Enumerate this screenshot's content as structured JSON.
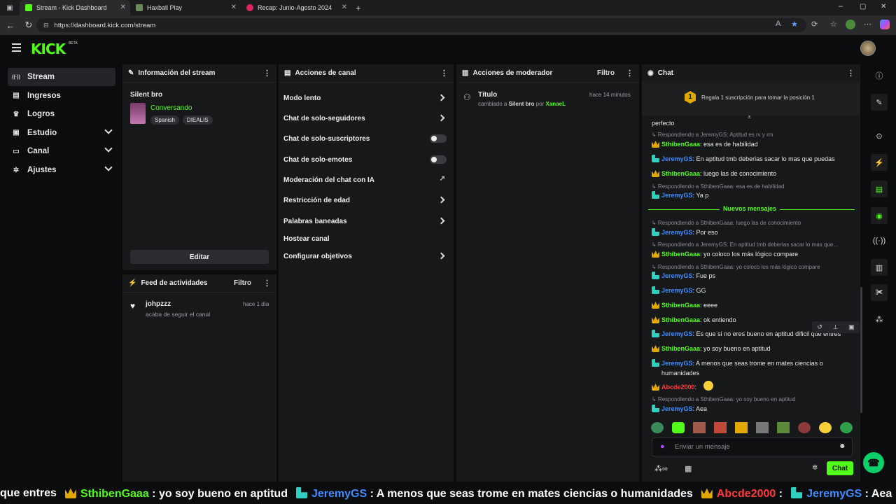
{
  "browser": {
    "tabs": [
      {
        "title": "Stream - Kick Dashboard",
        "active": true
      },
      {
        "title": "Haxball Play",
        "active": false
      },
      {
        "title": "Recap: Junio-Agosto 2024",
        "active": false
      }
    ],
    "url": "https://dashboard.kick.com/stream"
  },
  "app": {
    "logo": "KICK",
    "beta": "BETA"
  },
  "sidebar": {
    "items": [
      {
        "label": "Stream",
        "icon": "broadcast-icon",
        "active": true
      },
      {
        "label": "Ingresos",
        "icon": "revenue-icon"
      },
      {
        "label": "Logros",
        "icon": "trophy-icon"
      },
      {
        "label": "Estudio",
        "icon": "studio-icon",
        "expandable": true
      },
      {
        "label": "Canal",
        "icon": "channel-icon",
        "expandable": true
      },
      {
        "label": "Ajustes",
        "icon": "gear-icon",
        "expandable": true
      }
    ]
  },
  "stream_info": {
    "title": "Información del stream",
    "stream_title": "Silent bro",
    "category": "Conversando",
    "tags": [
      "Spanish",
      "DIEALIS"
    ],
    "edit_label": "Editar"
  },
  "activity": {
    "title": "Feed de actividades",
    "filter": "Filtro",
    "items": [
      {
        "user": "johpzzz",
        "text": "acaba de seguir el canal",
        "time": "hace 1 día"
      }
    ]
  },
  "channel_actions": {
    "title": "Acciones de canal",
    "items": [
      {
        "label": "Modo lento",
        "control": "arrow"
      },
      {
        "label": "Chat de solo-seguidores",
        "control": "arrow"
      },
      {
        "label": "Chat de solo-suscriptores",
        "control": "toggle"
      },
      {
        "label": "Chat de solo-emotes",
        "control": "toggle"
      },
      {
        "label": "Moderación del chat con IA",
        "control": "external"
      },
      {
        "label": "Restricción de edad",
        "control": "arrow"
      },
      {
        "label": "Palabras baneadas",
        "control": "arrow"
      },
      {
        "label": "Hostear canal",
        "control": "none"
      },
      {
        "label": "Configurar objetivos",
        "control": "arrow"
      }
    ]
  },
  "mod_actions": {
    "title": "Acciones de moderador",
    "filter": "Filtro",
    "items": [
      {
        "title": "Título",
        "text_pre": "cambiado a",
        "value": "Silent bro",
        "text_mid": "por",
        "user": "XanaeL",
        "time": "hace 14 minutos"
      }
    ]
  },
  "chat": {
    "title": "Chat",
    "gift_rank": "1",
    "gift_text": "Regala 1 suscripción para tomar la posición 1",
    "new_messages": "Nuevos mensajes",
    "input_placeholder": "Enviar un mensaje",
    "send_label": "Chat",
    "messages": [
      {
        "text": "perfecto"
      },
      {
        "reply": "Respondiendo a JeremyGS: Aptitud es rv y rm",
        "user": "SthibenGaaa",
        "badge": "sub",
        "color": "#53fc18",
        "text": "esa es de habilidad"
      },
      {
        "user": "JeremyGS",
        "badge": "mod",
        "color": "#3f8cff",
        "text": "En aptitud tmb deberias sacar lo mas que puedas"
      },
      {
        "user": "SthibenGaaa",
        "badge": "sub",
        "color": "#53fc18",
        "text": "luego las de conocimiento"
      },
      {
        "reply": "Respondiendo a SthibenGaaa: esa es de habilidad",
        "user": "JeremyGS",
        "badge": "mod",
        "color": "#3f8cff",
        "text": "Ya p"
      },
      {
        "reply": "Respondiendo a SthibenGaaa: luego las de conocimiento",
        "user": "JeremyGS",
        "badge": "mod",
        "color": "#3f8cff",
        "text": "Por eso"
      },
      {
        "reply": "Respondiendo a JeremyGS: En aptitud tmb deberias sacar lo mas que...",
        "user": "SthibenGaaa",
        "badge": "sub",
        "color": "#53fc18",
        "text": "yo coloco los más lógico compare"
      },
      {
        "reply": "Respondiendo a SthibenGaaa: yo coloco los más lógico compare",
        "user": "JeremyGS",
        "badge": "mod",
        "color": "#3f8cff",
        "text": "Fue ps"
      },
      {
        "user": "JeremyGS",
        "badge": "mod",
        "color": "#3f8cff",
        "text": "GG"
      },
      {
        "user": "SthibenGaaa",
        "badge": "sub",
        "color": "#53fc18",
        "text": "eeee"
      },
      {
        "user": "SthibenGaaa",
        "badge": "sub",
        "color": "#53fc18",
        "text": "ok entiendo"
      },
      {
        "user": "JeremyGS",
        "badge": "mod",
        "color": "#3f8cff",
        "text": "Es que si no eres bueno en aptitud dificil que entres"
      },
      {
        "user": "SthibenGaaa",
        "badge": "sub",
        "color": "#53fc18",
        "text": "yo soy bueno en aptitud"
      },
      {
        "user": "JeremyGS",
        "badge": "mod",
        "color": "#3f8cff",
        "text": "A menos que seas trome en mates ciencias o humanidades"
      },
      {
        "user": "Abcde2000",
        "badge": "sub",
        "color": "#ff3b3b",
        "text": ""
      },
      {
        "reply": "Respondiendo a SthibenGaaa: yo soy bueno en aptitud",
        "user": "JeremyGS",
        "badge": "mod",
        "color": "#3f8cff",
        "text": "Aea"
      }
    ]
  },
  "ticker": {
    "items": [
      {
        "text": "que entres"
      },
      {
        "user": "SthibenGaaa",
        "color": "#53fc18",
        "text": "yo soy bueno en aptitud"
      },
      {
        "user": "JeremyGS",
        "color": "#3f8cff",
        "text": "A menos que seas trome en mates ciencias o humanidades"
      },
      {
        "user": "Abcde2000",
        "color": "#ff3b3b",
        "text": ""
      },
      {
        "user": "JeremyGS",
        "color": "#3f8cff",
        "text": "Aea"
      }
    ]
  },
  "colors": {
    "accent": "#53fc18",
    "panel": "#17181a",
    "bg": "#0b0c0d"
  }
}
